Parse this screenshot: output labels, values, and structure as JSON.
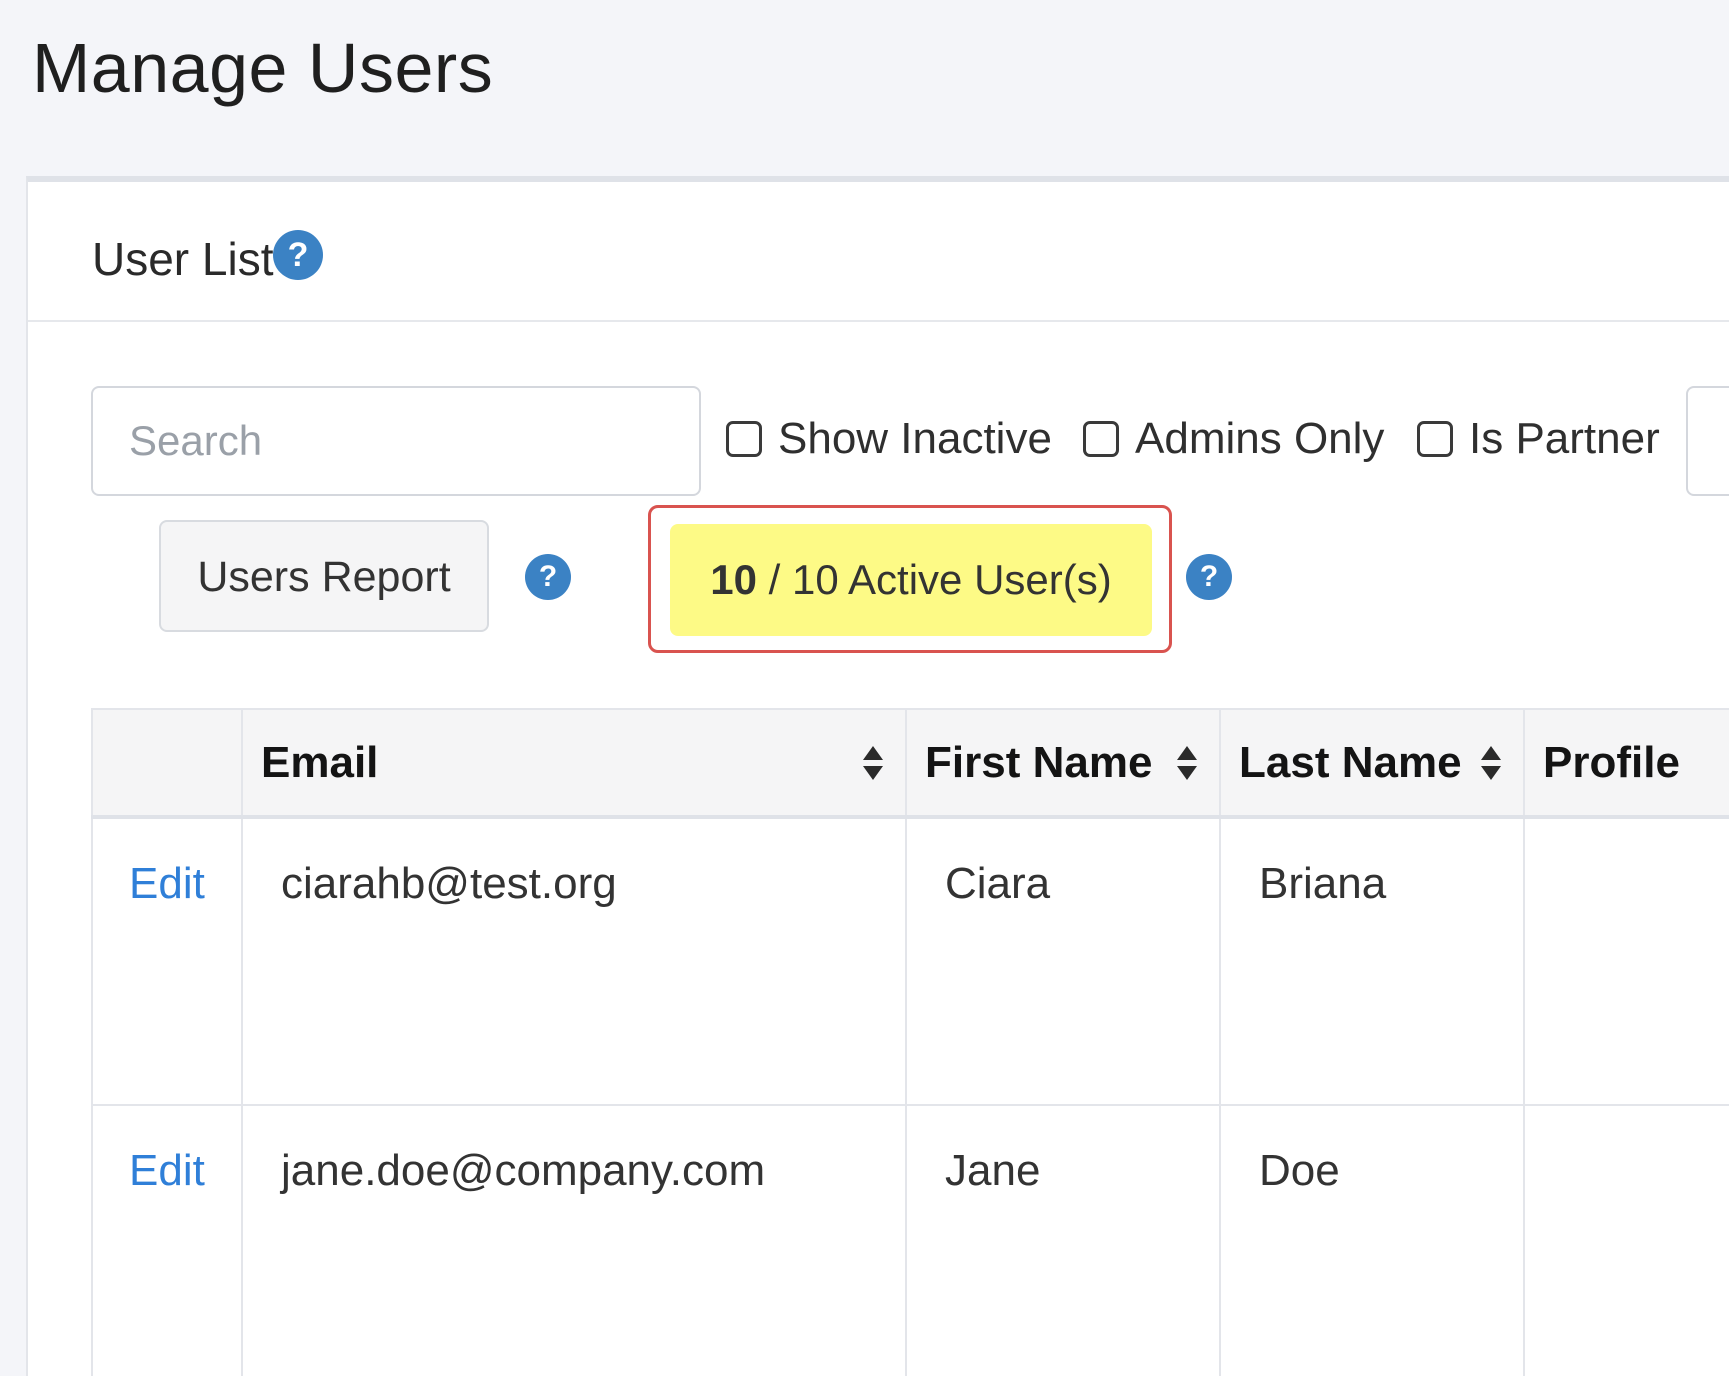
{
  "page": {
    "title": "Manage Users"
  },
  "panel": {
    "title": "User List",
    "help_icon": "question-circle-icon"
  },
  "filters": {
    "search_placeholder": "Search",
    "search_value": "",
    "checkboxes": [
      {
        "label": "Show Inactive",
        "checked": false
      },
      {
        "label": "Admins Only",
        "checked": false
      },
      {
        "label": "Is Partner",
        "checked": false
      }
    ]
  },
  "actions": {
    "users_report_label": "Users Report",
    "active_count_bold": "10",
    "active_count_rest": " / 10 Active User(s)",
    "highlight_color": "#d9534f",
    "badge_color": "#fdfa86"
  },
  "table": {
    "columns": [
      "Email",
      "First Name",
      "Last Name",
      "Profile"
    ],
    "rows": [
      {
        "action": "Edit",
        "email": "ciarahb@test.org",
        "first_name": "Ciara",
        "last_name": "Briana",
        "profile": ""
      },
      {
        "action": "Edit",
        "email": "jane.doe@company.com",
        "first_name": "Jane",
        "last_name": "Doe",
        "profile": ""
      }
    ]
  },
  "colors": {
    "accent": "#3b82c4",
    "link": "#2f7fd8",
    "background": "#f4f5f9"
  }
}
